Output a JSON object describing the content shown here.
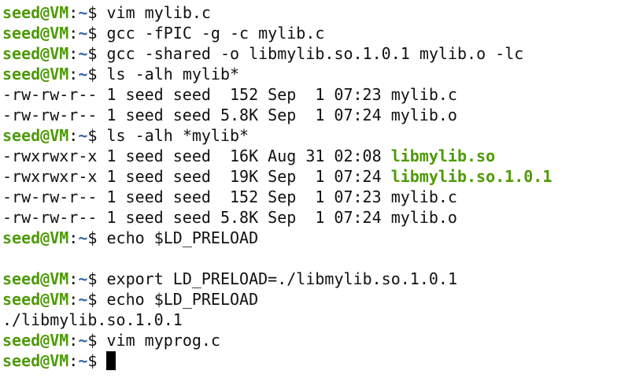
{
  "prompt": {
    "user_host": "seed@VM",
    "separator": ":",
    "path": "~",
    "symbol": "$ "
  },
  "lines": [
    {
      "type": "command",
      "text": "vim mylib.c"
    },
    {
      "type": "command",
      "text": "gcc -fPIC -g -c mylib.c"
    },
    {
      "type": "command",
      "text": "gcc -shared -o libmylib.so.1.0.1 mylib.o -lc"
    },
    {
      "type": "command",
      "text": "ls -alh mylib*"
    },
    {
      "type": "listing",
      "prefix": "-rw-rw-r-- 1 seed seed  152 Sep  1 07:23 ",
      "name": "mylib.c",
      "exec": false
    },
    {
      "type": "listing",
      "prefix": "-rw-rw-r-- 1 seed seed 5.8K Sep  1 07:24 ",
      "name": "mylib.o",
      "exec": false
    },
    {
      "type": "command",
      "text": "ls -alh *mylib*"
    },
    {
      "type": "listing",
      "prefix": "-rwxrwxr-x 1 seed seed  16K Aug 31 02:08 ",
      "name": "libmylib.so",
      "exec": true
    },
    {
      "type": "listing",
      "prefix": "-rwxrwxr-x 1 seed seed  19K Sep  1 07:24 ",
      "name": "libmylib.so.1.0.1",
      "exec": true
    },
    {
      "type": "listing",
      "prefix": "-rw-rw-r-- 1 seed seed  152 Sep  1 07:23 ",
      "name": "mylib.c",
      "exec": false
    },
    {
      "type": "listing",
      "prefix": "-rw-rw-r-- 1 seed seed 5.8K Sep  1 07:24 ",
      "name": "mylib.o",
      "exec": false
    },
    {
      "type": "command",
      "text": "echo $LD_PRELOAD"
    },
    {
      "type": "output",
      "text": ""
    },
    {
      "type": "command",
      "text": "export LD_PRELOAD=./libmylib.so.1.0.1"
    },
    {
      "type": "command",
      "text": "echo $LD_PRELOAD"
    },
    {
      "type": "output",
      "text": "./libmylib.so.1.0.1"
    },
    {
      "type": "command",
      "text": "vim myprog.c"
    },
    {
      "type": "command-active",
      "text": ""
    }
  ],
  "colors": {
    "prompt_user": "#4e9a06",
    "prompt_path": "#3465a4",
    "exec_file": "#4e9a06",
    "text": "#111111",
    "background": "#ffffff"
  }
}
